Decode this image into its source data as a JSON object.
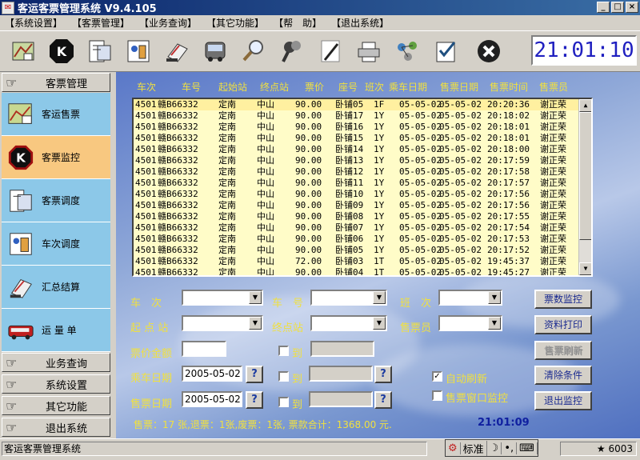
{
  "window": {
    "title": "客运客票管理系统 V9.4.105",
    "controls": [
      "_",
      "□",
      "×"
    ]
  },
  "menu": [
    "【系统设置】",
    "【客票管理】",
    "【业务查询】",
    "【其它功能】",
    "【帮　助】",
    "【退出系统】"
  ],
  "toolbar": {
    "icons": [
      "ticket-sale-icon",
      "k-monitor-icon",
      "ticket-dispatch-icon",
      "schedule-dispatch-icon",
      "summary-report-icon",
      "bus-icon",
      "magnifier-icon",
      "search-people-icon",
      "pen-icon",
      "printer-icon",
      "network-icon",
      "checklist-icon",
      "close-icon"
    ],
    "clock": "21:01:10"
  },
  "sidebar": {
    "sections": [
      {
        "label": "客票管理"
      },
      {
        "label": "业务查询"
      },
      {
        "label": "系统设置"
      },
      {
        "label": "其它功能"
      },
      {
        "label": "退出系统"
      }
    ],
    "items": [
      {
        "label": "客运售票",
        "icon": "map-ticket-icon"
      },
      {
        "label": "客票监控",
        "icon": "k-monitor-icon",
        "active": true
      },
      {
        "label": "客票调度",
        "icon": "ticket-dispatch-icon"
      },
      {
        "label": "车次调度",
        "icon": "schedule-dispatch-icon"
      },
      {
        "label": "汇总结算",
        "icon": "summary-report-icon"
      },
      {
        "label": "运 量 单",
        "icon": "bus-icon"
      }
    ]
  },
  "grid": {
    "columns": [
      "车次",
      "车号",
      "起始站",
      "终点站",
      "票价",
      "座号",
      "班次",
      "乘车日期",
      "售票日期",
      "售票时间",
      "售票员"
    ],
    "rows": [
      [
        "4501",
        "赣B66332",
        "定南",
        "中山",
        "90.00",
        "卧铺05",
        "1F",
        "05-05-02",
        "05-05-02",
        "20:20:36",
        "谢正荣"
      ],
      [
        "4501",
        "赣B66332",
        "定南",
        "中山",
        "90.00",
        "卧铺17",
        "1Y",
        "05-05-02",
        "05-05-02",
        "20:18:02",
        "谢正荣"
      ],
      [
        "4501",
        "赣B66332",
        "定南",
        "中山",
        "90.00",
        "卧铺16",
        "1Y",
        "05-05-02",
        "05-05-02",
        "20:18:01",
        "谢正荣"
      ],
      [
        "4501",
        "赣B66332",
        "定南",
        "中山",
        "90.00",
        "卧铺15",
        "1Y",
        "05-05-02",
        "05-05-02",
        "20:18:01",
        "谢正荣"
      ],
      [
        "4501",
        "赣B66332",
        "定南",
        "中山",
        "90.00",
        "卧铺14",
        "1Y",
        "05-05-02",
        "05-05-02",
        "20:18:00",
        "谢正荣"
      ],
      [
        "4501",
        "赣B66332",
        "定南",
        "中山",
        "90.00",
        "卧铺13",
        "1Y",
        "05-05-02",
        "05-05-02",
        "20:17:59",
        "谢正荣"
      ],
      [
        "4501",
        "赣B66332",
        "定南",
        "中山",
        "90.00",
        "卧铺12",
        "1Y",
        "05-05-02",
        "05-05-02",
        "20:17:58",
        "谢正荣"
      ],
      [
        "4501",
        "赣B66332",
        "定南",
        "中山",
        "90.00",
        "卧铺11",
        "1Y",
        "05-05-02",
        "05-05-02",
        "20:17:57",
        "谢正荣"
      ],
      [
        "4501",
        "赣B66332",
        "定南",
        "中山",
        "90.00",
        "卧铺10",
        "1Y",
        "05-05-02",
        "05-05-02",
        "20:17:56",
        "谢正荣"
      ],
      [
        "4501",
        "赣B66332",
        "定南",
        "中山",
        "90.00",
        "卧铺09",
        "1Y",
        "05-05-02",
        "05-05-02",
        "20:17:56",
        "谢正荣"
      ],
      [
        "4501",
        "赣B66332",
        "定南",
        "中山",
        "90.00",
        "卧铺08",
        "1Y",
        "05-05-02",
        "05-05-02",
        "20:17:55",
        "谢正荣"
      ],
      [
        "4501",
        "赣B66332",
        "定南",
        "中山",
        "90.00",
        "卧铺07",
        "1Y",
        "05-05-02",
        "05-05-02",
        "20:17:54",
        "谢正荣"
      ],
      [
        "4501",
        "赣B66332",
        "定南",
        "中山",
        "90.00",
        "卧铺06",
        "1Y",
        "05-05-02",
        "05-05-02",
        "20:17:53",
        "谢正荣"
      ],
      [
        "4501",
        "赣B66332",
        "定南",
        "中山",
        "90.00",
        "卧铺05",
        "1Y",
        "05-05-02",
        "05-05-02",
        "20:17:52",
        "谢正荣"
      ],
      [
        "4501",
        "赣B66332",
        "定南",
        "中山",
        "72.00",
        "卧铺03",
        "1T",
        "05-05-02",
        "05-05-02",
        "19:45:37",
        "谢正荣"
      ],
      [
        "4501",
        "赣B66332",
        "定南",
        "中山",
        "90.00",
        "卧铺04",
        "1T",
        "05-05-02",
        "05-05-02",
        "19:45:27",
        "谢正荣"
      ]
    ]
  },
  "filters": {
    "train_no": "车　次",
    "bus_no": "车　号",
    "shift": "班　次",
    "start_station": "起 点 站",
    "end_station": "终点站",
    "seller": "售票员",
    "price": "票价金额",
    "to1": "到",
    "ride_date_label": "乘车日期",
    "ride_date": "2005-05-02",
    "to2": "到",
    "sale_date_label": "售票日期",
    "sale_date": "2005-05-02",
    "to3": "到",
    "q": "?",
    "auto_refresh": "自动刷新",
    "window_monitor": "售票窗口监控"
  },
  "buttons": {
    "ticket_monitor": "票数监控",
    "print": "资料打印",
    "refresh": "售票刷新",
    "clear": "清除条件",
    "exit": "退出监控"
  },
  "summary": {
    "text": "售票：17 张,退票：1张,废票：1张, 票款合计：1368.00 元.",
    "time": "21:01:09"
  },
  "status": {
    "app": "客运客票管理系统",
    "ime": [
      "标准",
      "☽",
      "•,",
      "⌨"
    ],
    "user": "★ 6003"
  }
}
